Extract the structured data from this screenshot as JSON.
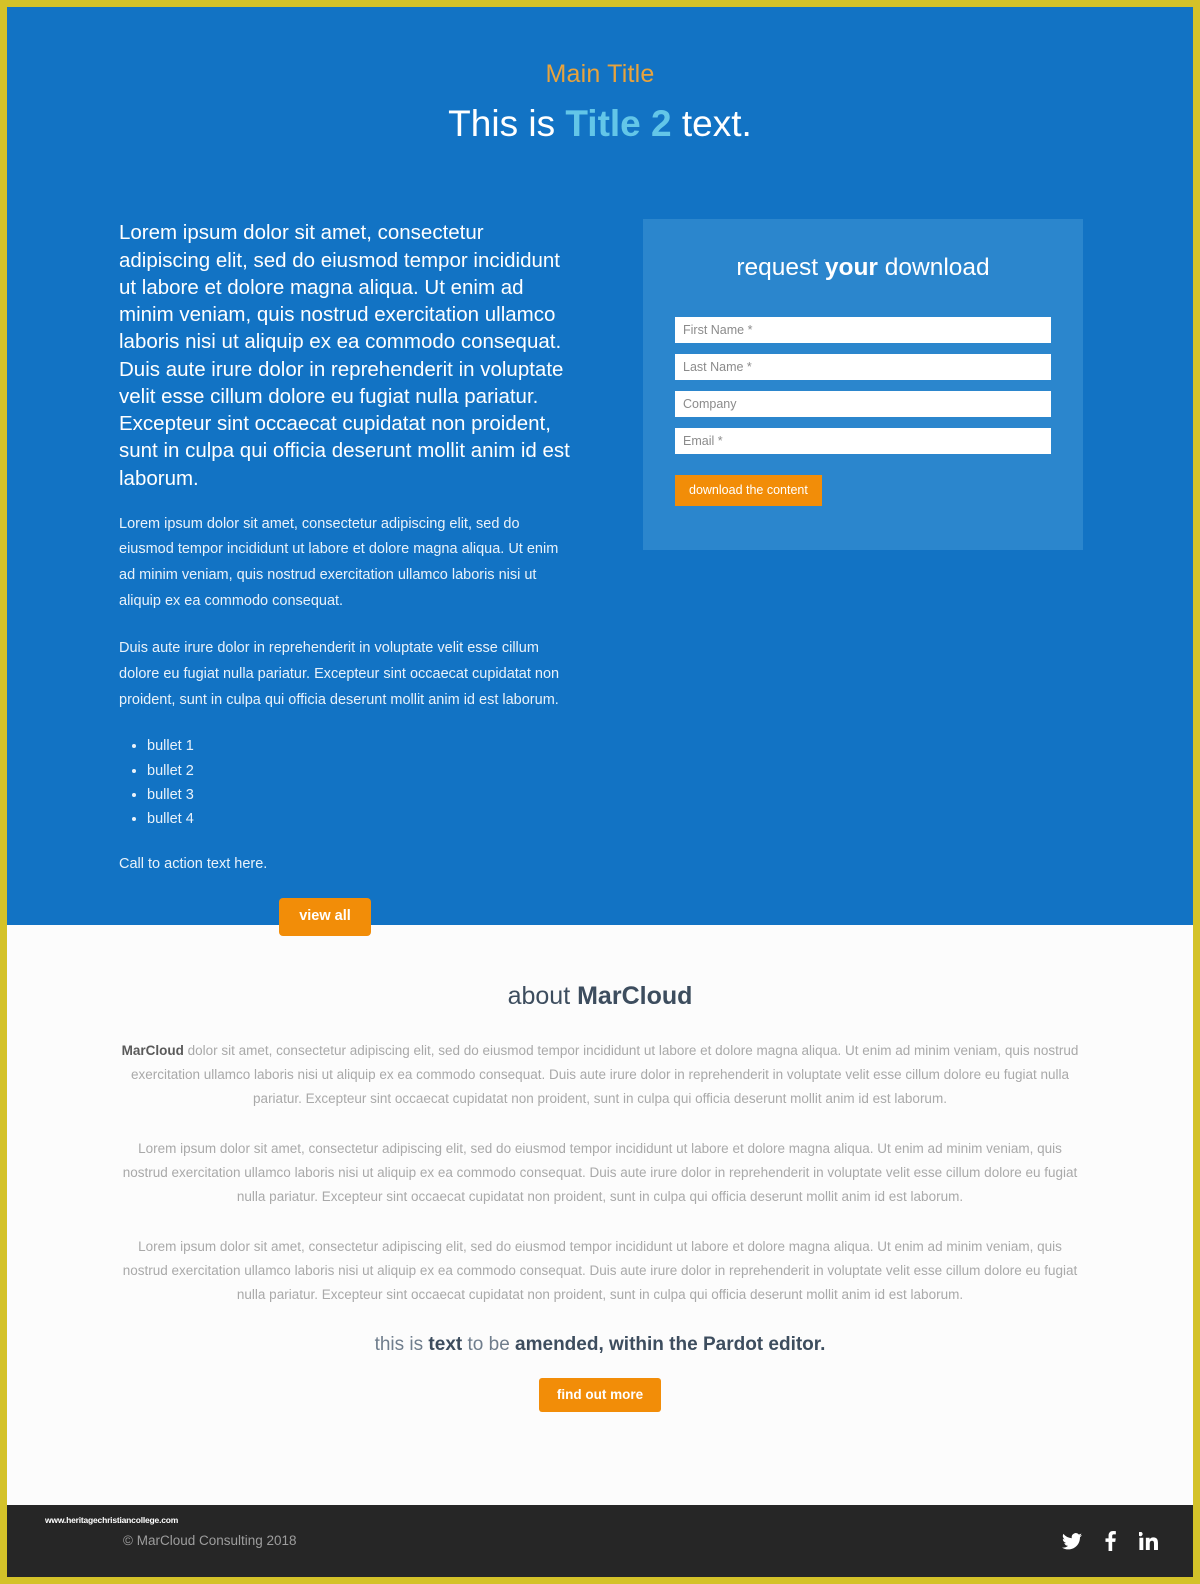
{
  "theme": {
    "page_border": "#d4c229",
    "hero_bg": "#1273c4",
    "form_card_bg": "#2b86cd",
    "accent_orange": "#f28d08",
    "main_title_color": "#e8a33d",
    "title2_accent_color": "#63c6e8",
    "about_bg": "#fcfcfc",
    "footer_bg": "#262626"
  },
  "hero": {
    "main_title": "Main Title",
    "title2_prefix": "This is ",
    "title2_accent": "Title 2",
    "title2_suffix": " text.",
    "lead_paragraph": "Lorem ipsum dolor sit amet, consectetur adipiscing elit, sed do eiusmod tempor incididunt ut labore et dolore magna aliqua. Ut enim ad minim veniam, quis nostrud exercitation ullamco laboris nisi ut aliquip ex ea commodo consequat. Duis aute irure dolor in reprehenderit in voluptate velit esse cillum dolore eu fugiat nulla pariatur. Excepteur sint occaecat cupidatat non proident, sunt in culpa qui officia deserunt mollit anim id est laborum.",
    "paragraph_1": "Lorem ipsum dolor sit amet, consectetur adipiscing elit, sed do eiusmod tempor incididunt ut labore et dolore magna aliqua. Ut enim ad minim veniam, quis nostrud exercitation ullamco laboris nisi ut aliquip ex ea commodo consequat.",
    "paragraph_2": "Duis aute irure dolor in reprehenderit in voluptate velit esse cillum dolore eu fugiat nulla pariatur. Excepteur sint occaecat cupidatat non proident, sunt in culpa qui officia deserunt mollit anim id est laborum.",
    "bullets": [
      "bullet 1",
      "bullet 2",
      "bullet 3",
      "bullet 4"
    ],
    "cta_text": "Call to action text here.",
    "view_all_label": "view all"
  },
  "form": {
    "title_prefix": "request ",
    "title_bold": "your",
    "title_suffix": " download",
    "fields": [
      {
        "name": "first-name",
        "placeholder": "First Name *",
        "value": ""
      },
      {
        "name": "last-name",
        "placeholder": "Last Name *",
        "value": ""
      },
      {
        "name": "company",
        "placeholder": "Company",
        "value": ""
      },
      {
        "name": "email",
        "placeholder": "Email *",
        "value": ""
      }
    ],
    "submit_label": "download the content"
  },
  "about": {
    "title_prefix": "about ",
    "title_bold": "MarCloud",
    "paragraph_1_bold": "MarCloud",
    "paragraph_1_rest": " dolor sit amet, consectetur adipiscing elit, sed do eiusmod tempor incididunt ut labore et dolore magna aliqua. Ut enim ad minim veniam, quis nostrud exercitation ullamco laboris nisi ut aliquip ex ea commodo consequat. Duis aute irure dolor in reprehenderit in voluptate velit esse cillum dolore eu fugiat nulla pariatur. Excepteur sint occaecat cupidatat non proident, sunt in culpa qui officia deserunt mollit anim id est laborum.",
    "paragraph_2": "Lorem ipsum dolor sit amet, consectetur adipiscing elit, sed do eiusmod tempor incididunt ut labore et dolore magna aliqua. Ut enim ad minim veniam, quis nostrud exercitation ullamco laboris nisi ut aliquip ex ea commodo consequat. Duis aute irure dolor in reprehenderit in voluptate velit esse cillum dolore eu fugiat nulla pariatur. Excepteur sint occaecat cupidatat non proident, sunt in culpa qui officia deserunt mollit anim id est laborum.",
    "paragraph_3": "Lorem ipsum dolor sit amet, consectetur adipiscing elit, sed do eiusmod tempor incididunt ut labore et dolore magna aliqua. Ut enim ad minim veniam, quis nostrud exercitation ullamco laboris nisi ut aliquip ex ea commodo consequat. Duis aute irure dolor in reprehenderit in voluptate velit esse cillum dolore eu fugiat nulla pariatur. Excepteur sint occaecat cupidatat non proident, sunt in culpa qui officia deserunt mollit anim id est laborum.",
    "amend_part_1": "this is ",
    "amend_bold_1": "text",
    "amend_part_2": " to be ",
    "amend_bold_2": "amended, within the Pardot editor.",
    "find_out_more_label": "find out more"
  },
  "footer": {
    "watermark": "www.heritagechristiancollege.com",
    "copyright": "© MarCloud Consulting 2018",
    "socials": [
      {
        "name": "twitter-icon",
        "label": "Twitter"
      },
      {
        "name": "facebook-icon",
        "label": "Facebook"
      },
      {
        "name": "linkedin-icon",
        "label": "LinkedIn"
      }
    ]
  }
}
